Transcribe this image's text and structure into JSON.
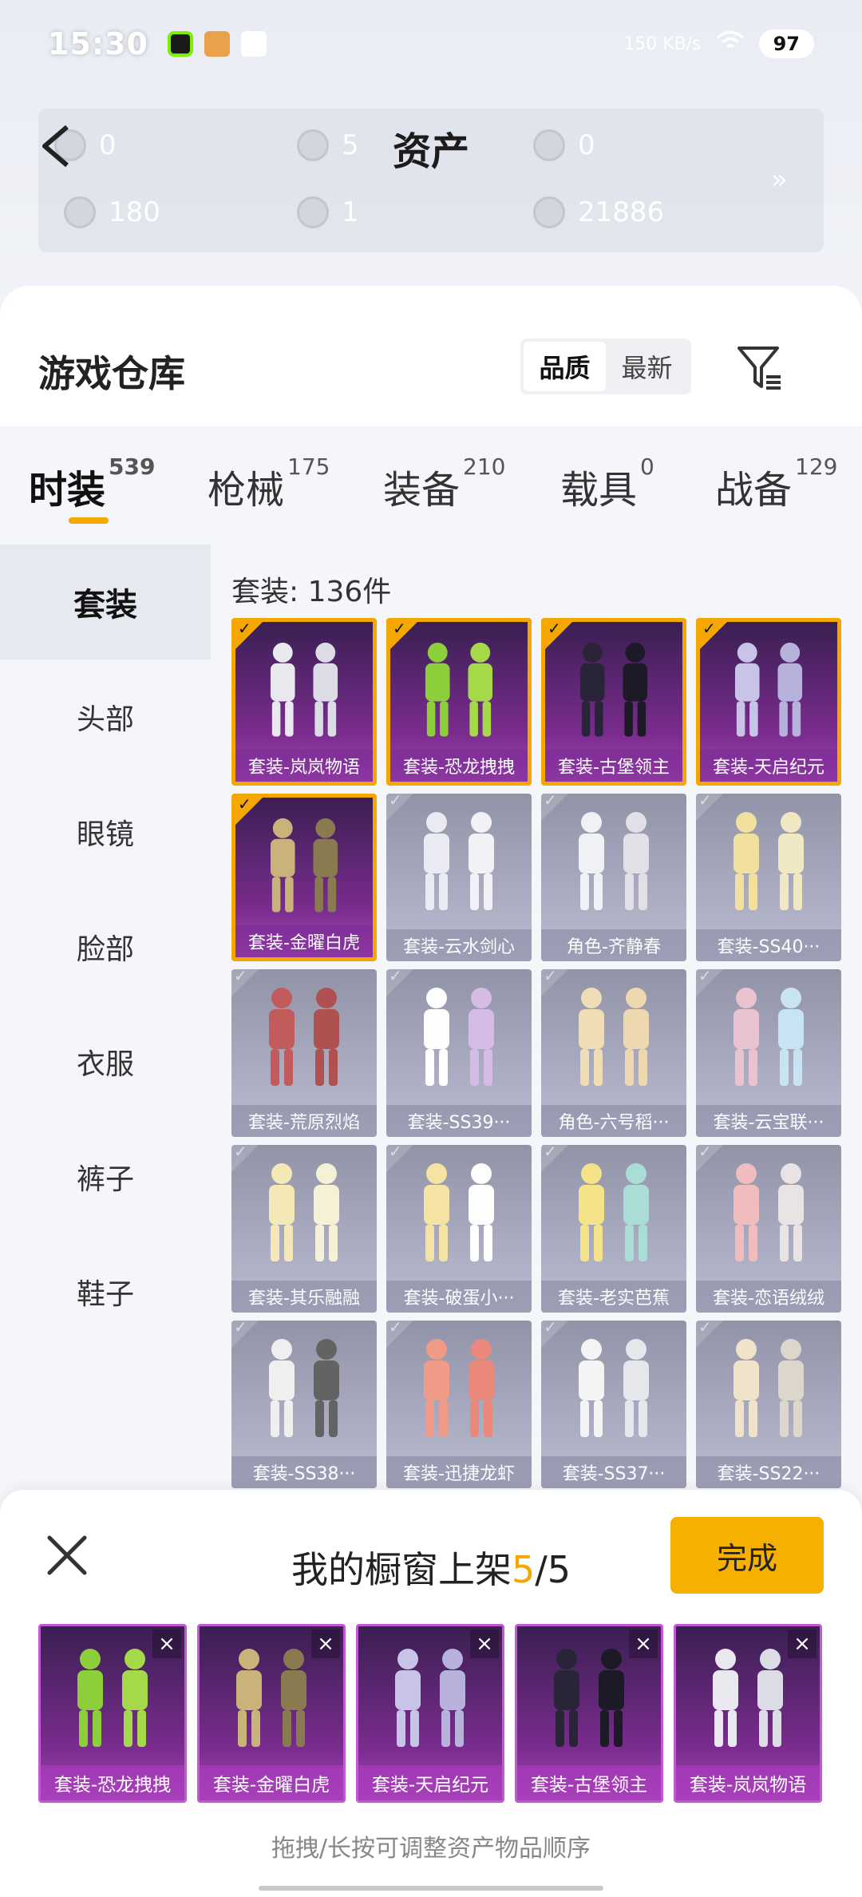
{
  "status_bar": {
    "time": "15:30",
    "battery": "97",
    "net_speed": "150 KB/s"
  },
  "asset_header": {
    "title": "资产",
    "items": [
      {
        "value": "0"
      },
      {
        "value": "5"
      },
      {
        "value": "0"
      },
      {
        "value": "180"
      },
      {
        "value": "1"
      },
      {
        "value": "21886"
      }
    ],
    "more": "»"
  },
  "warehouse": {
    "title": "游戏仓库",
    "sort_options": [
      "品质",
      "最新"
    ],
    "sort_active": "品质"
  },
  "tabs": [
    {
      "label": "时装",
      "count": "539"
    },
    {
      "label": "枪械",
      "count": "175"
    },
    {
      "label": "装备",
      "count": "210"
    },
    {
      "label": "载具",
      "count": "0"
    },
    {
      "label": "战备",
      "count": "129"
    }
  ],
  "categories": [
    "套装",
    "头部",
    "眼镜",
    "脸部",
    "衣服",
    "裤子",
    "鞋子"
  ],
  "grid": {
    "count_label": "套装: 136件",
    "items": [
      {
        "label": "套装-岚岚物语",
        "selected": true
      },
      {
        "label": "套装-恐龙拽拽",
        "selected": true
      },
      {
        "label": "套装-古堡领主",
        "selected": true
      },
      {
        "label": "套装-天启纪元",
        "selected": true
      },
      {
        "label": "套装-金曜白虎",
        "selected": true
      },
      {
        "label": "套装-云水剑心",
        "selected": false
      },
      {
        "label": "角色-齐静春",
        "selected": false
      },
      {
        "label": "套装-SS40···",
        "selected": false
      },
      {
        "label": "套装-荒原烈焰",
        "selected": false
      },
      {
        "label": "套装-SS39···",
        "selected": false
      },
      {
        "label": "角色-六号稻···",
        "selected": false
      },
      {
        "label": "套装-云宝联···",
        "selected": false
      },
      {
        "label": "套装-其乐融融",
        "selected": false
      },
      {
        "label": "套装-破蛋小···",
        "selected": false
      },
      {
        "label": "套装-老实芭蕉",
        "selected": false
      },
      {
        "label": "套装-恋语绒绒",
        "selected": false
      },
      {
        "label": "套装-SS38···",
        "selected": false
      },
      {
        "label": "套装-迅捷龙虾",
        "selected": false
      },
      {
        "label": "套装-SS37···",
        "selected": false
      },
      {
        "label": "套装-SS22···",
        "selected": false
      }
    ]
  },
  "showcase": {
    "title_prefix": "我的橱窗上架",
    "current": "5",
    "separator": "/",
    "max": "5",
    "done_label": "完成",
    "slots": [
      "套装-恐龙拽拽",
      "套装-金曜白虎",
      "套装-天启纪元",
      "套装-古堡领主",
      "套装-岚岚物语"
    ],
    "hint": "拖拽/长按可调整资产物品顺序"
  },
  "colors": {
    "accent": "#f3a700",
    "legendary_bg": "#7a2c8e",
    "locked_bg": "#9b9cb5"
  }
}
